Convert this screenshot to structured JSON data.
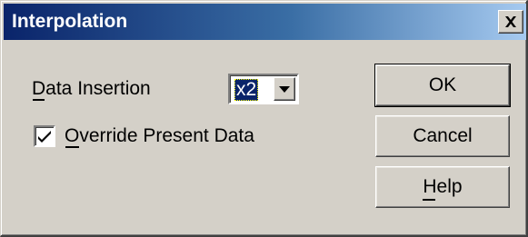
{
  "window": {
    "title": "Interpolation"
  },
  "titlebar": {
    "close_icon": "close-x-icon"
  },
  "form": {
    "data_insertion_label": "Data Insertion",
    "data_insertion_value": "x2",
    "override_label": "Override Present Data",
    "override_checked": true
  },
  "buttons": {
    "ok": "OK",
    "cancel": "Cancel",
    "help": "Help"
  },
  "colors": {
    "titlebar_start": "#0a246a",
    "titlebar_end": "#a6caf0",
    "dialog_face": "#d4d0c8",
    "selection": "#0a246a"
  }
}
